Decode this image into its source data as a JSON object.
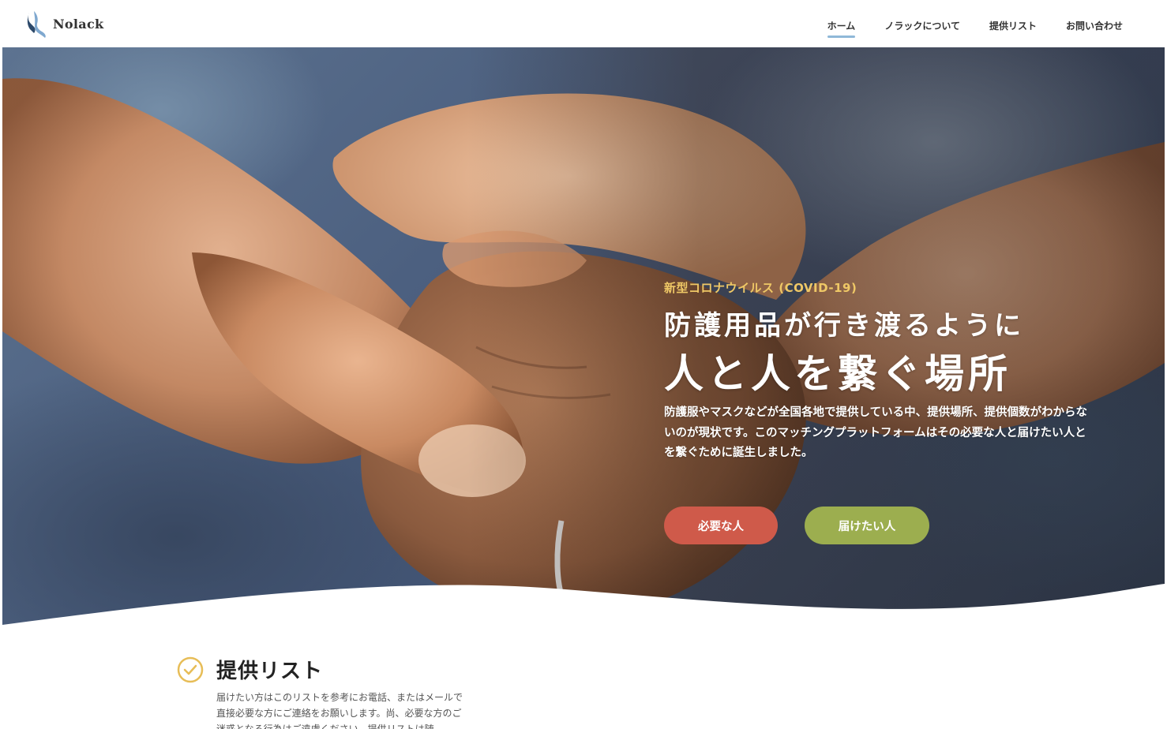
{
  "header": {
    "logo_text": "Nolack",
    "nav": [
      {
        "label": "ホーム",
        "active": true
      },
      {
        "label": "ノラックについて",
        "active": false
      },
      {
        "label": "提供リスト",
        "active": false
      },
      {
        "label": "お問い合わせ",
        "active": false
      }
    ]
  },
  "hero": {
    "eyebrow": "新型コロナウイルス (COVID-19)",
    "headline_line1": "防護用品が行き渡るように",
    "headline_line2": "人と人を繋ぐ場所",
    "description": "防護服やマスクなどが全国各地で提供している中、提供場所、提供個数がわからないのが現状です。このマッチングプラットフォームはその必要な人と届けたい人とを繋ぐために誕生しました。",
    "cta_need": "必要な人",
    "cta_give": "届けたい人"
  },
  "section": {
    "title": "提供リスト",
    "description": "届けたい方はこのリストを参考にお電話、またはメールで直接必要な方にご連絡をお願いします。尚、必要な方のご迷惑となる行為はご遠慮ください。提供リストは随"
  },
  "colors": {
    "eyebrow": "#efc866",
    "cta_need": "#cf5a4a",
    "cta_give": "#9cae4f",
    "check_accent": "#e7bd57",
    "nav_underline": "#8fb8d8"
  },
  "icons": {
    "logo": "nolack-logo-icon",
    "section": "check-circle-icon"
  }
}
